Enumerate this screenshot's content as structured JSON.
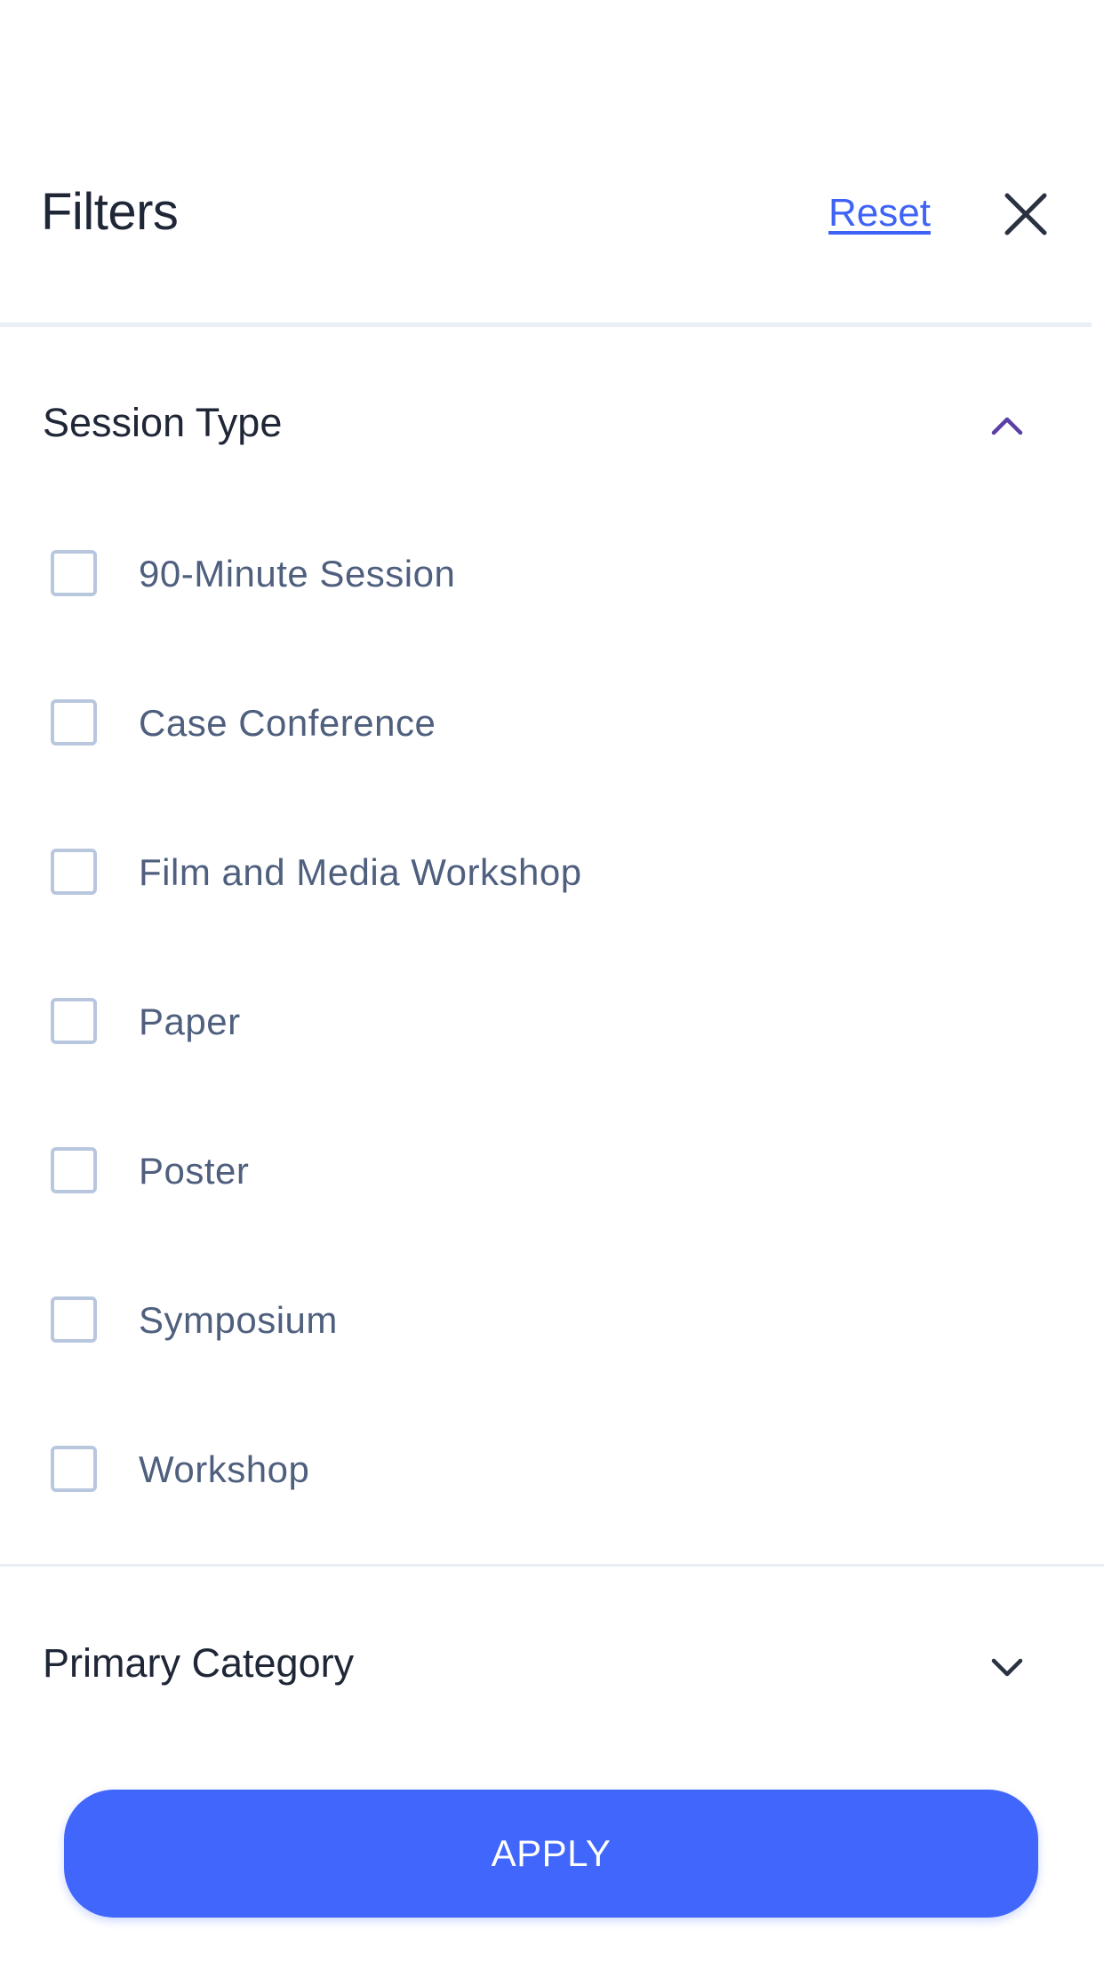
{
  "header": {
    "title": "Filters",
    "reset_label": "Reset",
    "close_icon": "close-icon"
  },
  "sections": [
    {
      "title": "Session Type",
      "expanded": true,
      "chevron_icon": "chevron-up-icon",
      "options": [
        {
          "label": "90-Minute Session",
          "checked": false
        },
        {
          "label": "Case Conference",
          "checked": false
        },
        {
          "label": "Film and Media Workshop",
          "checked": false
        },
        {
          "label": "Paper",
          "checked": false
        },
        {
          "label": "Poster",
          "checked": false
        },
        {
          "label": "Symposium",
          "checked": false
        },
        {
          "label": "Workshop",
          "checked": false
        }
      ]
    },
    {
      "title": "Primary Category",
      "expanded": false,
      "chevron_icon": "chevron-down-icon"
    }
  ],
  "apply_label": "APPLY",
  "colors": {
    "accent": "#4066fb",
    "link": "#3f63f5",
    "title_text": "#1f2636",
    "option_text": "#4f5f7e",
    "checkbox_border": "#b8c7de",
    "chevron_up": "#5b3fa5",
    "chevron_down": "#2a3140",
    "divider": "#e9eff5"
  }
}
